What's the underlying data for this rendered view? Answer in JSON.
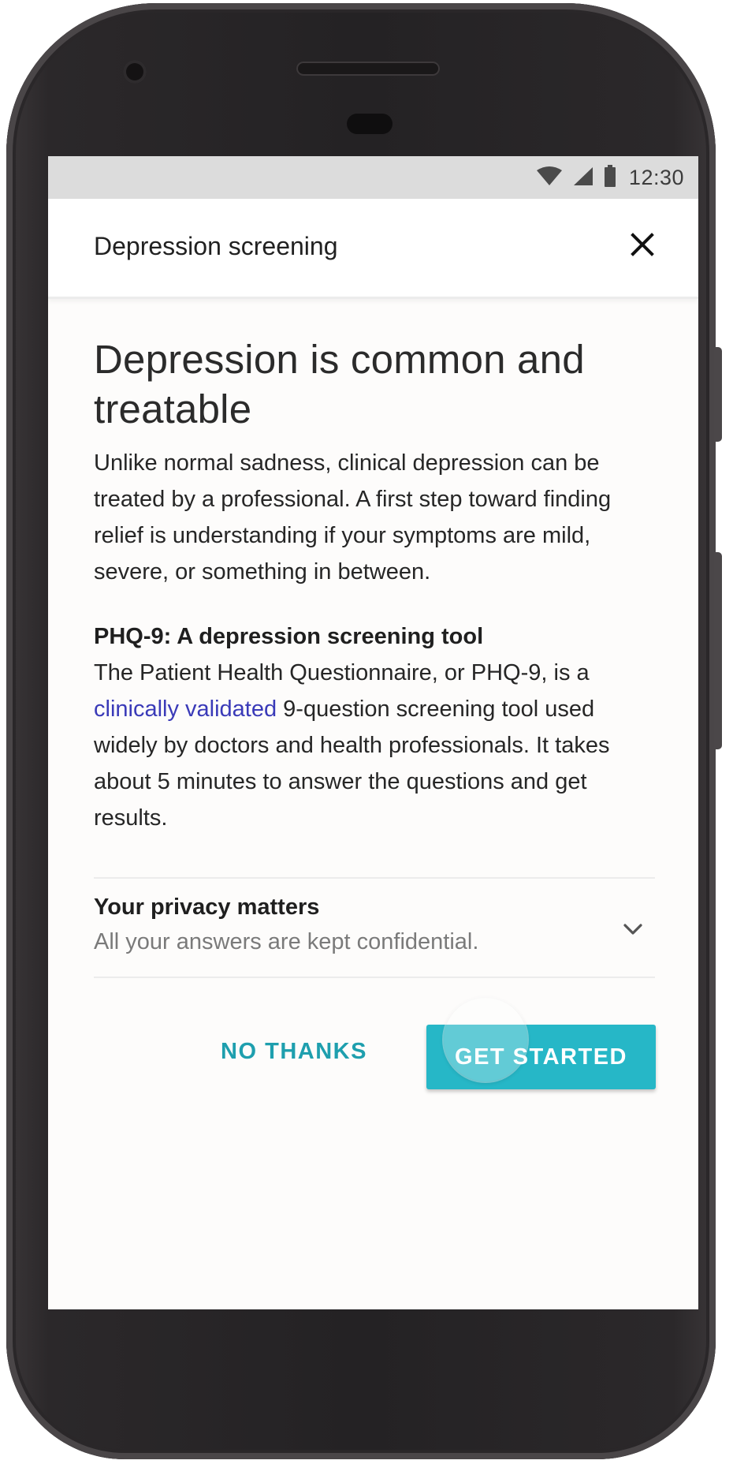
{
  "status_bar": {
    "time": "12:30",
    "icons": [
      "wifi-icon",
      "cell-signal-icon",
      "battery-icon"
    ]
  },
  "app_bar": {
    "title": "Depression screening",
    "close_icon": "close-icon"
  },
  "main": {
    "headline": "Depression is common and treatable",
    "intro": "Unlike normal sadness, clinical depression can be treated by a professional. A first step toward finding relief is understanding if your symptoms are mild, severe, or something in between.",
    "phq_title": "PHQ-9: A depression screening tool",
    "phq_body_before_link": "The Patient Health Questionnaire, or PHQ-9, is a ",
    "phq_link": "clinically validated",
    "phq_body_after_link": " 9-question screening tool used widely by doctors and health professionals. It takes about 5 minutes to answer the questions and get results."
  },
  "privacy": {
    "title": "Your privacy matters",
    "subtitle": "All your answers are kept confidential.",
    "expand_icon": "chevron-down-icon"
  },
  "actions": {
    "no_thanks": "NO THANKS",
    "get_started": "GET STARTED"
  },
  "colors": {
    "accent": "#26b7c7",
    "accent_text": "#1e9fae",
    "link": "#3a3ab8",
    "device_frame": "#2b282a"
  }
}
